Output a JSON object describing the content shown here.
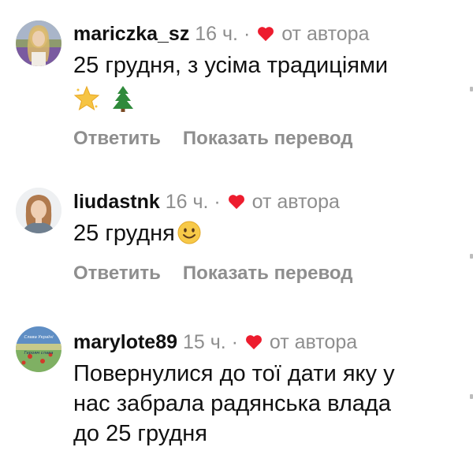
{
  "labels": {
    "byauthor": "от автора",
    "reply": "Ответить",
    "translate": "Показать перевод"
  },
  "colors": {
    "username": "#111111",
    "secondary": "#8e8e8e",
    "heart": "#ed1c2e"
  },
  "comments": [
    {
      "username": "mariczka_sz",
      "time": "16 ч.",
      "separator": "·",
      "text_line1": "25 грудня, з усіма традиціями",
      "emoji": [
        "star-emoji",
        "christmas-tree-emoji"
      ]
    },
    {
      "username": "liudastnk",
      "time": "16 ч.",
      "separator": "·",
      "text_line1": "25 грудня",
      "emoji": [
        "smiley-emoji"
      ]
    },
    {
      "username": "marylote89",
      "time": "15 ч.",
      "separator": "·",
      "text_line1": "Повернулися до тої дати яку у",
      "text_line2": "нас забрала радянська влада",
      "text_line3": "до 25 грудня",
      "avatar_text_top": "Слава Україні",
      "avatar_text_bottom": "Героям слава"
    }
  ]
}
